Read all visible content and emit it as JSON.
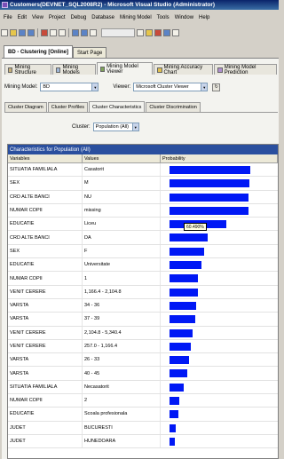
{
  "window": {
    "title": "Customers(DEVNET_SQL2008R2) - Microsoft Visual Studio (Administrator)"
  },
  "menu": [
    "File",
    "Edit",
    "View",
    "Project",
    "Debug",
    "Database",
    "Mining Model",
    "Tools",
    "Window",
    "Help"
  ],
  "doc_tabs": [
    "BD - Clustering [Online]",
    "Start Page"
  ],
  "viewer_tabs": [
    "Mining Structure",
    "Mining Models",
    "Mining Model Viewer",
    "Mining Accuracy Chart",
    "Mining Model Prediction"
  ],
  "model_bar": {
    "mining_model_label": "Mining Model:",
    "mining_model_value": "BD",
    "viewer_label": "Viewer:",
    "viewer_value": "Microsoft Cluster Viewer"
  },
  "sub_tabs": [
    "Cluster Diagram",
    "Cluster Profiles",
    "Cluster Characteristics",
    "Cluster Discrimination"
  ],
  "cluster": {
    "label": "Cluster:",
    "value": "Population (All)"
  },
  "grid": {
    "caption": "Characteristics for Population (All)",
    "headers": [
      "Variables",
      "Values",
      "Probability"
    ],
    "rows": [
      {
        "variable": "SITUATIA FAMILIALA",
        "value": "Casatorit",
        "probability": 0.85
      },
      {
        "variable": "SEX",
        "value": "M",
        "probability": 0.84
      },
      {
        "variable": "CRD ALTE BANCI",
        "value": "NU",
        "probability": 0.83
      },
      {
        "variable": "NUMAR COPII",
        "value": "missing",
        "probability": 0.83
      },
      {
        "variable": "EDUCATIE",
        "value": "Liceu",
        "probability": 0.6
      },
      {
        "variable": "CRD ALTE BANCI",
        "value": "DA",
        "probability": 0.4
      },
      {
        "variable": "SEX",
        "value": "F",
        "probability": 0.36
      },
      {
        "variable": "EDUCATIE",
        "value": "Universitate",
        "probability": 0.34
      },
      {
        "variable": "NUMAR COPII",
        "value": "1",
        "probability": 0.3
      },
      {
        "variable": "VENIT CERERE",
        "value": "1,166.4 - 2,104.8",
        "probability": 0.3
      },
      {
        "variable": "VARSTA",
        "value": "34 - 36",
        "probability": 0.28
      },
      {
        "variable": "VARSTA",
        "value": "37 - 39",
        "probability": 0.27
      },
      {
        "variable": "VENIT CERERE",
        "value": "2,104.8 - 5,340.4",
        "probability": 0.24
      },
      {
        "variable": "VENIT CERERE",
        "value": "257.0 - 1,166.4",
        "probability": 0.22
      },
      {
        "variable": "VARSTA",
        "value": "26 - 33",
        "probability": 0.21
      },
      {
        "variable": "VARSTA",
        "value": "40 - 45",
        "probability": 0.19
      },
      {
        "variable": "SITUATIA FAMILIALA",
        "value": "Necasatorit",
        "probability": 0.15
      },
      {
        "variable": "NUMAR COPII",
        "value": "2",
        "probability": 0.1
      },
      {
        "variable": "EDUCATIE",
        "value": "Scoala profesionala",
        "probability": 0.09
      },
      {
        "variable": "JUDET",
        "value": "BUCURESTI",
        "probability": 0.07
      },
      {
        "variable": "JUDET",
        "value": "HUNEDOARA",
        "probability": 0.06
      }
    ]
  },
  "tooltip": {
    "text": "60.490%"
  },
  "colors": {
    "bar": "#0018f5",
    "caption_bg": "#2a4f9e",
    "title_bg": "#0a246a"
  }
}
